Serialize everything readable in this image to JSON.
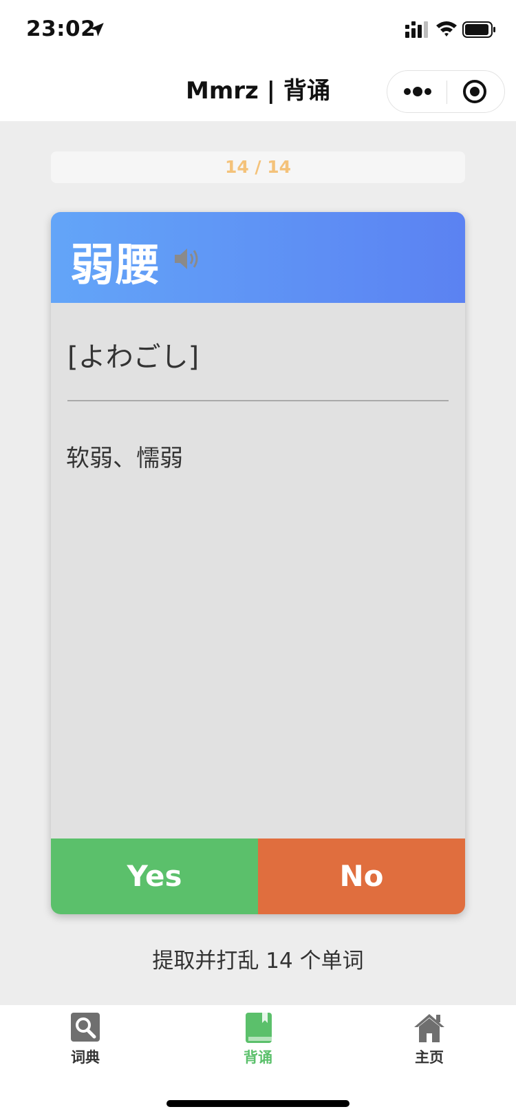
{
  "status_bar": {
    "time": "23:02",
    "icons": [
      "location-arrow-icon",
      "signal-icon",
      "wifi-icon",
      "battery-icon"
    ]
  },
  "nav": {
    "title": "Mmrz | 背诵",
    "capsule_icons": [
      "more-icon",
      "close-target-icon"
    ]
  },
  "progress": {
    "text": "14 / 14",
    "fraction": 1.0,
    "text_color": "#f4c27a"
  },
  "card": {
    "word": "弱腰",
    "reading": "[よわごし]",
    "meaning": "软弱、懦弱",
    "speaker_icon": "speaker-icon",
    "header_gradient": [
      "#63a5f8",
      "#5b82f2"
    ],
    "yes_label": "Yes",
    "no_label": "No",
    "yes_color": "#5bc06b",
    "no_color": "#e06e3e"
  },
  "extract_text": "提取并打乱 14 个单词",
  "tab_bar": {
    "tabs": [
      {
        "label": "词典",
        "icon": "search-icon",
        "active": false
      },
      {
        "label": "背诵",
        "icon": "book-icon",
        "active": true
      },
      {
        "label": "主页",
        "icon": "home-icon",
        "active": false
      }
    ],
    "active_color": "#5bc06b"
  }
}
